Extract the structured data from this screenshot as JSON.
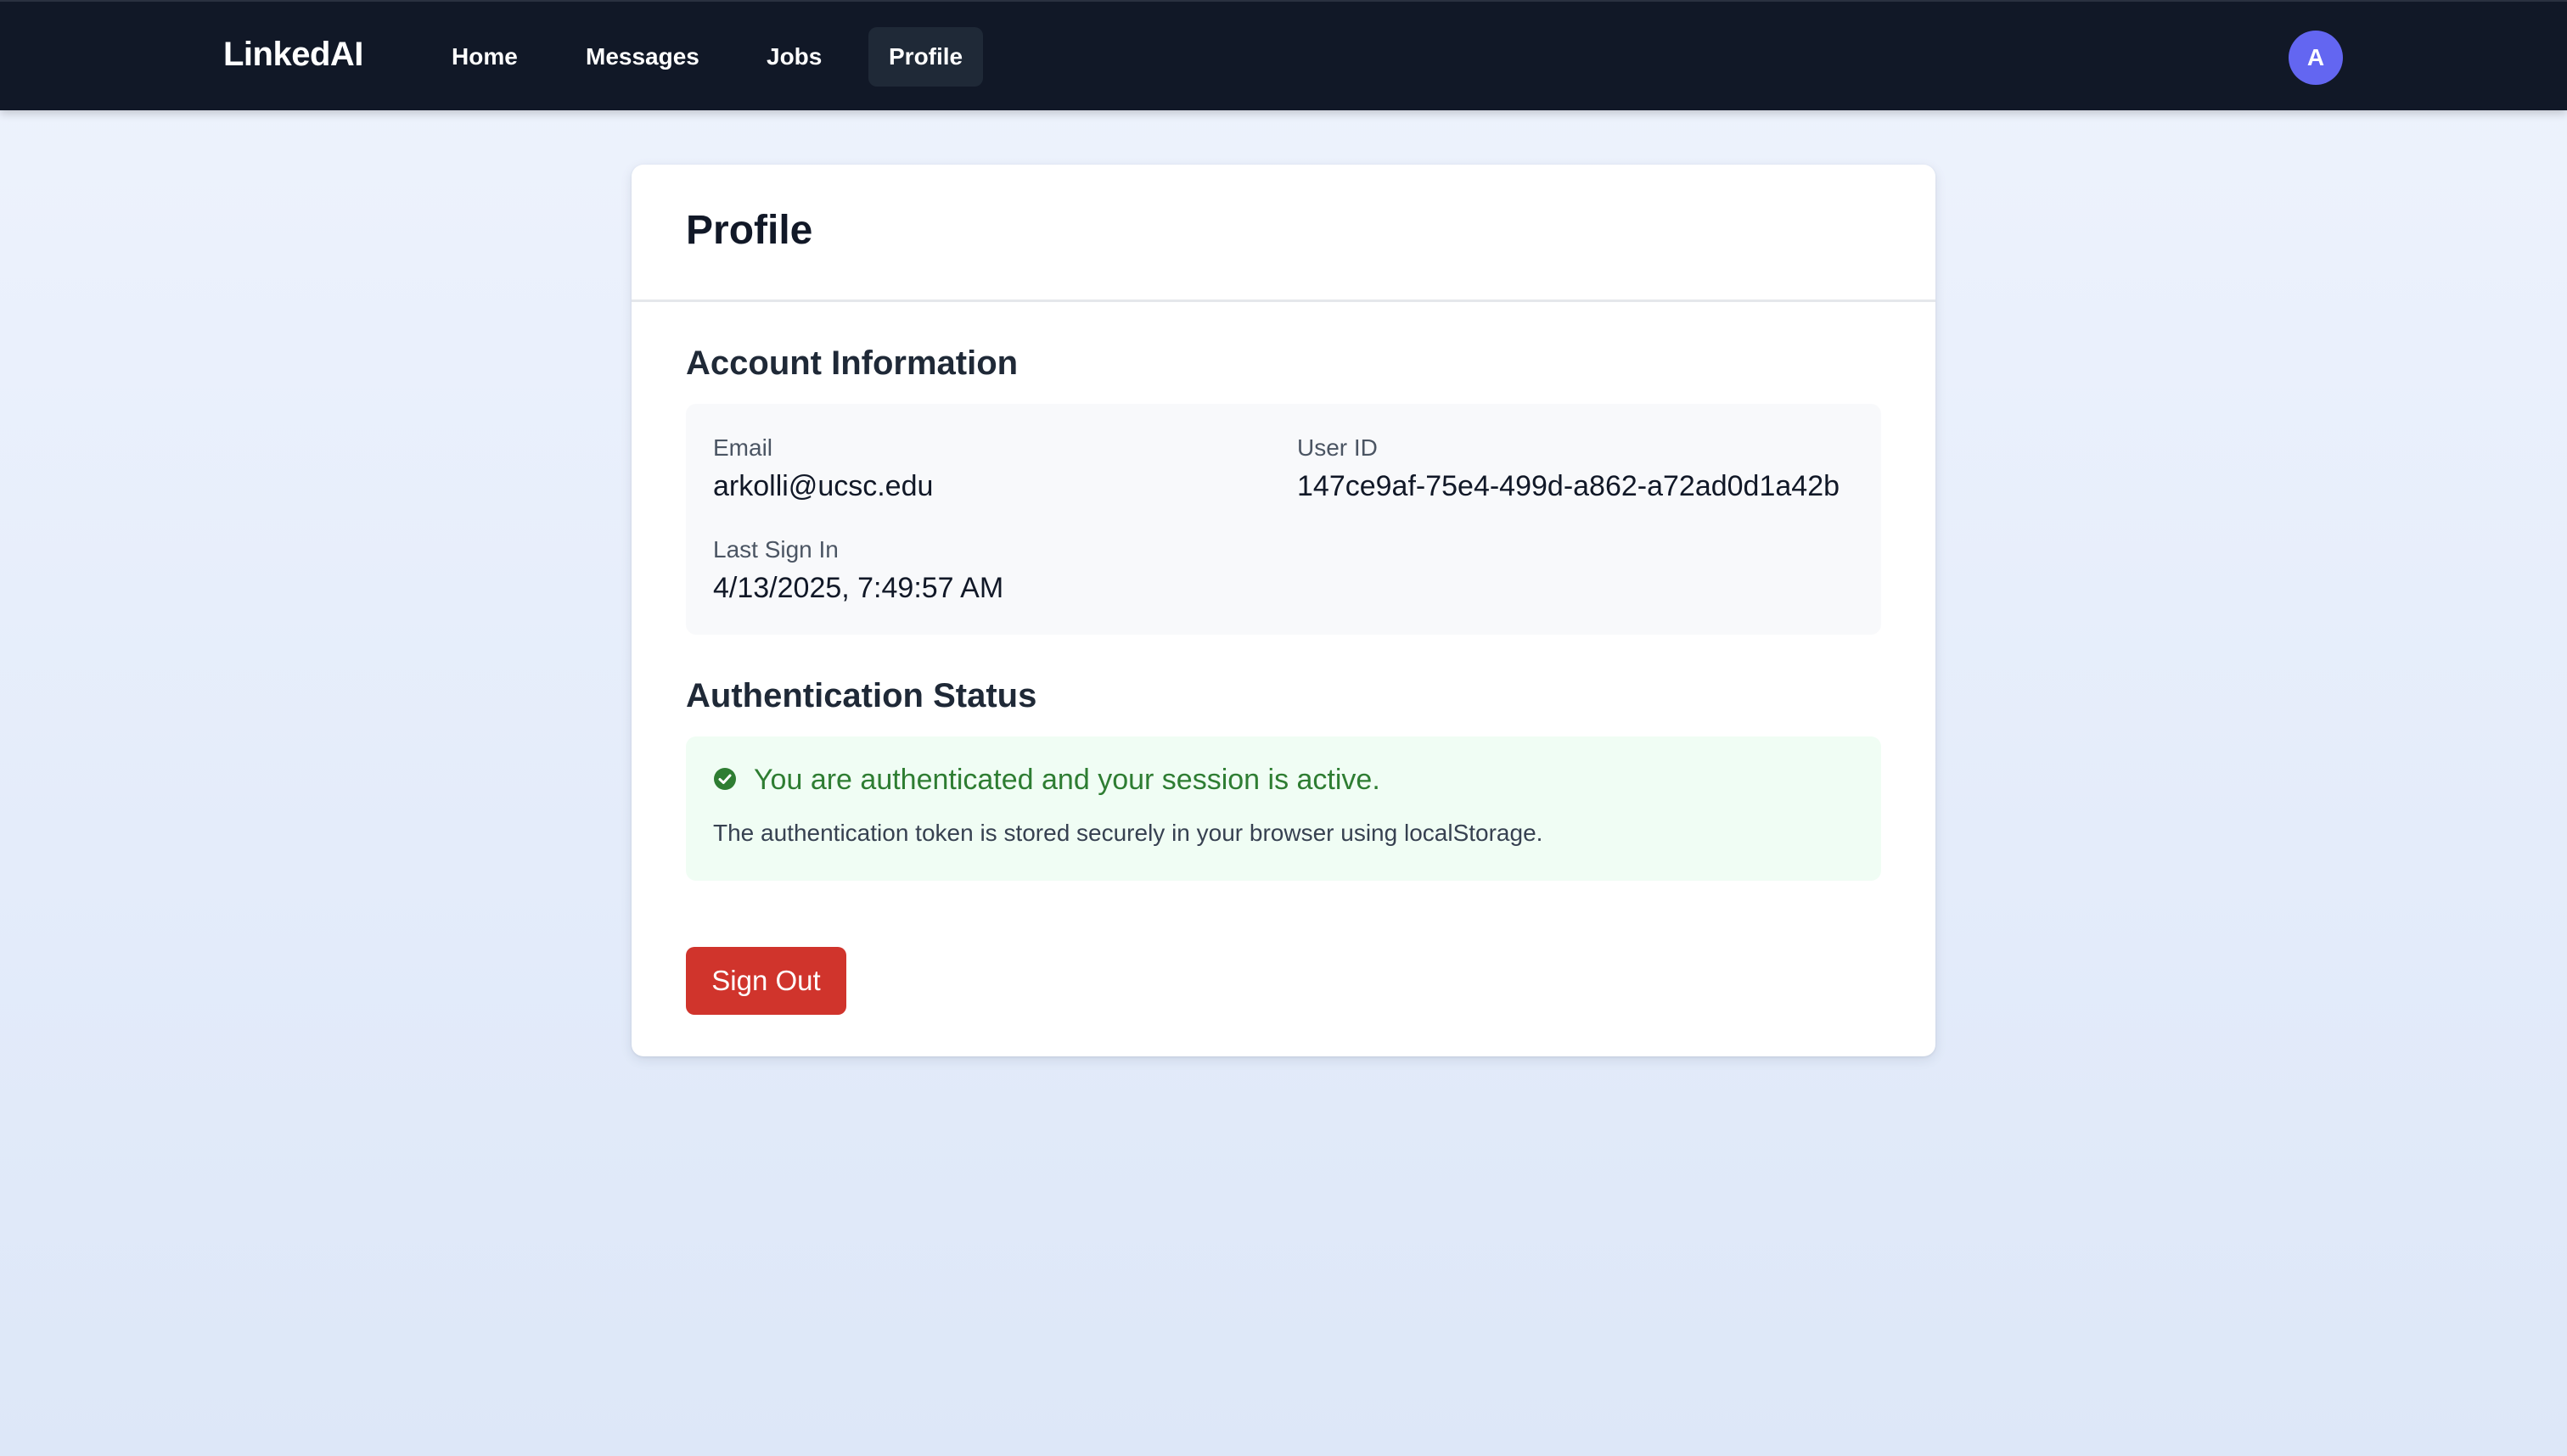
{
  "navbar": {
    "brand": "LinkedAI",
    "links": [
      {
        "label": "Home"
      },
      {
        "label": "Messages"
      },
      {
        "label": "Jobs"
      },
      {
        "label": "Profile",
        "active": true
      }
    ],
    "avatar_initial": "A"
  },
  "profile": {
    "title": "Profile",
    "account": {
      "heading": "Account Information",
      "email_label": "Email",
      "email_value": "arkolli@ucsc.edu",
      "user_id_label": "User ID",
      "user_id_value": "147ce9af-75e4-499d-a862-a72ad0d1a42b",
      "last_sign_in_label": "Last Sign In",
      "last_sign_in_value": "4/13/2025, 7:49:57 AM"
    },
    "auth": {
      "heading": "Authentication Status",
      "status_icon": "check-circle-icon",
      "status_text": "You are authenticated and your session is active.",
      "note": "The authentication token is stored securely in your browser using localStorage."
    },
    "sign_out_label": "Sign Out"
  },
  "colors": {
    "navbar_bg": "#111827",
    "avatar_bg": "#6366f1",
    "success_text": "#2e7d32",
    "success_bg": "#f0fdf4",
    "danger_button": "#d0342c"
  }
}
